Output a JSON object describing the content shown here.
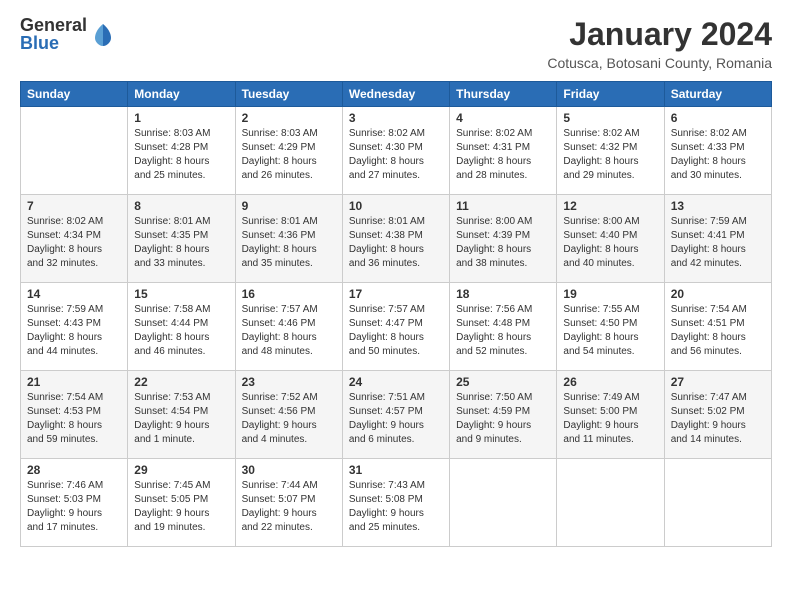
{
  "logo": {
    "general": "General",
    "blue": "Blue"
  },
  "title": "January 2024",
  "location": "Cotusca, Botosani County, Romania",
  "days_of_week": [
    "Sunday",
    "Monday",
    "Tuesday",
    "Wednesday",
    "Thursday",
    "Friday",
    "Saturday"
  ],
  "weeks": [
    [
      {
        "day": "",
        "info": ""
      },
      {
        "day": "1",
        "info": "Sunrise: 8:03 AM\nSunset: 4:28 PM\nDaylight: 8 hours\nand 25 minutes."
      },
      {
        "day": "2",
        "info": "Sunrise: 8:03 AM\nSunset: 4:29 PM\nDaylight: 8 hours\nand 26 minutes."
      },
      {
        "day": "3",
        "info": "Sunrise: 8:02 AM\nSunset: 4:30 PM\nDaylight: 8 hours\nand 27 minutes."
      },
      {
        "day": "4",
        "info": "Sunrise: 8:02 AM\nSunset: 4:31 PM\nDaylight: 8 hours\nand 28 minutes."
      },
      {
        "day": "5",
        "info": "Sunrise: 8:02 AM\nSunset: 4:32 PM\nDaylight: 8 hours\nand 29 minutes."
      },
      {
        "day": "6",
        "info": "Sunrise: 8:02 AM\nSunset: 4:33 PM\nDaylight: 8 hours\nand 30 minutes."
      }
    ],
    [
      {
        "day": "7",
        "info": "Sunrise: 8:02 AM\nSunset: 4:34 PM\nDaylight: 8 hours\nand 32 minutes."
      },
      {
        "day": "8",
        "info": "Sunrise: 8:01 AM\nSunset: 4:35 PM\nDaylight: 8 hours\nand 33 minutes."
      },
      {
        "day": "9",
        "info": "Sunrise: 8:01 AM\nSunset: 4:36 PM\nDaylight: 8 hours\nand 35 minutes."
      },
      {
        "day": "10",
        "info": "Sunrise: 8:01 AM\nSunset: 4:38 PM\nDaylight: 8 hours\nand 36 minutes."
      },
      {
        "day": "11",
        "info": "Sunrise: 8:00 AM\nSunset: 4:39 PM\nDaylight: 8 hours\nand 38 minutes."
      },
      {
        "day": "12",
        "info": "Sunrise: 8:00 AM\nSunset: 4:40 PM\nDaylight: 8 hours\nand 40 minutes."
      },
      {
        "day": "13",
        "info": "Sunrise: 7:59 AM\nSunset: 4:41 PM\nDaylight: 8 hours\nand 42 minutes."
      }
    ],
    [
      {
        "day": "14",
        "info": "Sunrise: 7:59 AM\nSunset: 4:43 PM\nDaylight: 8 hours\nand 44 minutes."
      },
      {
        "day": "15",
        "info": "Sunrise: 7:58 AM\nSunset: 4:44 PM\nDaylight: 8 hours\nand 46 minutes."
      },
      {
        "day": "16",
        "info": "Sunrise: 7:57 AM\nSunset: 4:46 PM\nDaylight: 8 hours\nand 48 minutes."
      },
      {
        "day": "17",
        "info": "Sunrise: 7:57 AM\nSunset: 4:47 PM\nDaylight: 8 hours\nand 50 minutes."
      },
      {
        "day": "18",
        "info": "Sunrise: 7:56 AM\nSunset: 4:48 PM\nDaylight: 8 hours\nand 52 minutes."
      },
      {
        "day": "19",
        "info": "Sunrise: 7:55 AM\nSunset: 4:50 PM\nDaylight: 8 hours\nand 54 minutes."
      },
      {
        "day": "20",
        "info": "Sunrise: 7:54 AM\nSunset: 4:51 PM\nDaylight: 8 hours\nand 56 minutes."
      }
    ],
    [
      {
        "day": "21",
        "info": "Sunrise: 7:54 AM\nSunset: 4:53 PM\nDaylight: 8 hours\nand 59 minutes."
      },
      {
        "day": "22",
        "info": "Sunrise: 7:53 AM\nSunset: 4:54 PM\nDaylight: 9 hours\nand 1 minute."
      },
      {
        "day": "23",
        "info": "Sunrise: 7:52 AM\nSunset: 4:56 PM\nDaylight: 9 hours\nand 4 minutes."
      },
      {
        "day": "24",
        "info": "Sunrise: 7:51 AM\nSunset: 4:57 PM\nDaylight: 9 hours\nand 6 minutes."
      },
      {
        "day": "25",
        "info": "Sunrise: 7:50 AM\nSunset: 4:59 PM\nDaylight: 9 hours\nand 9 minutes."
      },
      {
        "day": "26",
        "info": "Sunrise: 7:49 AM\nSunset: 5:00 PM\nDaylight: 9 hours\nand 11 minutes."
      },
      {
        "day": "27",
        "info": "Sunrise: 7:47 AM\nSunset: 5:02 PM\nDaylight: 9 hours\nand 14 minutes."
      }
    ],
    [
      {
        "day": "28",
        "info": "Sunrise: 7:46 AM\nSunset: 5:03 PM\nDaylight: 9 hours\nand 17 minutes."
      },
      {
        "day": "29",
        "info": "Sunrise: 7:45 AM\nSunset: 5:05 PM\nDaylight: 9 hours\nand 19 minutes."
      },
      {
        "day": "30",
        "info": "Sunrise: 7:44 AM\nSunset: 5:07 PM\nDaylight: 9 hours\nand 22 minutes."
      },
      {
        "day": "31",
        "info": "Sunrise: 7:43 AM\nSunset: 5:08 PM\nDaylight: 9 hours\nand 25 minutes."
      },
      {
        "day": "",
        "info": ""
      },
      {
        "day": "",
        "info": ""
      },
      {
        "day": "",
        "info": ""
      }
    ]
  ]
}
